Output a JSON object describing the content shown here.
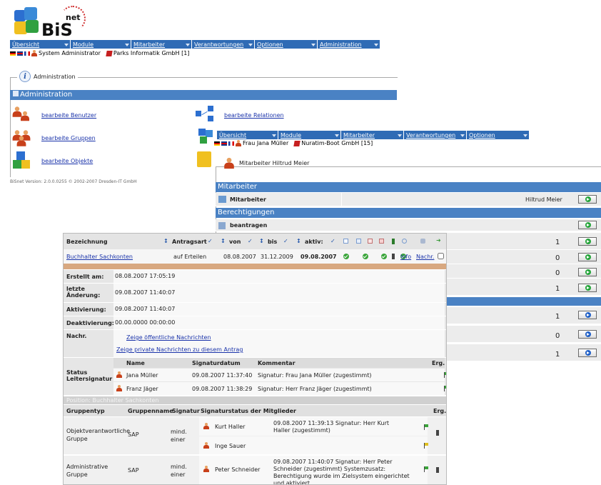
{
  "logo": {
    "text1": "BiS",
    "text2": "net"
  },
  "window1": {
    "nav": [
      {
        "label": "Übersicht"
      },
      {
        "label": "Module"
      },
      {
        "label": "Mitarbeiter"
      },
      {
        "label": "Verantwortungen"
      },
      {
        "label": "Optionen"
      },
      {
        "label": "Administration"
      }
    ],
    "user": "System Administrator",
    "org": "Parks Informatik GmbH [1]",
    "legend": "Administration",
    "header": "Administration",
    "links": {
      "users": "bearbeite Benutzer",
      "relations": "bearbeite Relationen",
      "groups": "bearbeite Gruppen",
      "objects": "bearbeite Objekte"
    },
    "version": "BiSnet Version: 2.0.0.0255 © 2002-2007 Dresden-IT GmbH"
  },
  "window2": {
    "nav": [
      {
        "label": "Übersicht"
      },
      {
        "label": "Module"
      },
      {
        "label": "Mitarbeiter"
      },
      {
        "label": "Verantwortungen"
      },
      {
        "label": "Optionen"
      }
    ],
    "user": "Frau Jana Müller",
    "org": "Nuratim-Boot GmbH [15]",
    "legend": "Mitarbeiter Hiltrud Meier",
    "sec1": "Mitarbeiter",
    "row_label": "Mitarbeiter",
    "row_value": "Hiltrud Meier",
    "sec2": "Berechtigungen",
    "beantragen": "beantragen",
    "counts": [
      "1",
      "0",
      "0",
      "1",
      "1",
      "0",
      "1"
    ]
  },
  "window3": {
    "headers": {
      "bez": "Bezeichnung",
      "antrag": "Antragsart",
      "von": "von",
      "bis": "bis",
      "aktiv": "aktiv:"
    },
    "row": {
      "name": "Buchhalter Sachkonten",
      "art": "auf Erteilen",
      "von": "08.08.2007",
      "bis": "31.12.2009",
      "aktiv": "09.08.2007",
      "info": "Info",
      "nachr": "Nachr."
    },
    "details": [
      {
        "label": "Erstellt am:",
        "value": "08.08.2007 17:05:19"
      },
      {
        "label": "letzte Änderung:",
        "value": "09.08.2007 11:40:07"
      },
      {
        "label": "Aktivierung:",
        "value": "09.08.2007 11:40:07"
      },
      {
        "label": "Deaktivierung:",
        "value": "00.00.0000 00:00:00"
      }
    ],
    "nachr_label": "Nachr.",
    "link_public": "Zeige öffentliche Nachrichten",
    "link_private": "Zeige private Nachrichten zu diesem Antrag",
    "status_label": "Status Leitersignatur",
    "sig_headers": {
      "name": "Name",
      "datum": "Signaturdatum",
      "kommentar": "Kommentar",
      "erg": "Erg."
    },
    "sigs": [
      {
        "name": "Jana Müller",
        "datum": "09.08.2007 11:37:40",
        "kommentar": "Signatur:  Frau Jana Müller (zugestimmt)"
      },
      {
        "name": "Franz Jäger",
        "datum": "09.08.2007 11:38:29",
        "kommentar": "Signatur:  Herr Franz Jäger (zugestimmt)"
      }
    ],
    "position": "Position: Buchhalter Sachkonten",
    "grp_headers": {
      "typ": "Gruppentyp",
      "name": "Gruppenname",
      "sig": "Signatur",
      "status": "Signaturstatus der Mitglieder",
      "erg": "Erg."
    },
    "groups": [
      {
        "typ": "Objektverantwortliche Gruppe",
        "name": "SAP",
        "sig": "mind. einer",
        "members": [
          {
            "name": "Kurt Haller",
            "text": "09.08.2007 11:39:13 Signatur:  Herr Kurt Haller (zugestimmt)"
          },
          {
            "name": "Inge Sauer",
            "text": ""
          }
        ]
      },
      {
        "typ": "Administrative Gruppe",
        "name": "SAP",
        "sig": "mind. einer",
        "members": [
          {
            "name": "Peter Schneider",
            "text": "09.08.2007 11:40:07 Signatur:  Herr Peter Schneider (zugestimmt) Systemzusatz: Berechtigung wurde im Zielsystem eingerichtet und aktiviert."
          }
        ]
      }
    ]
  }
}
